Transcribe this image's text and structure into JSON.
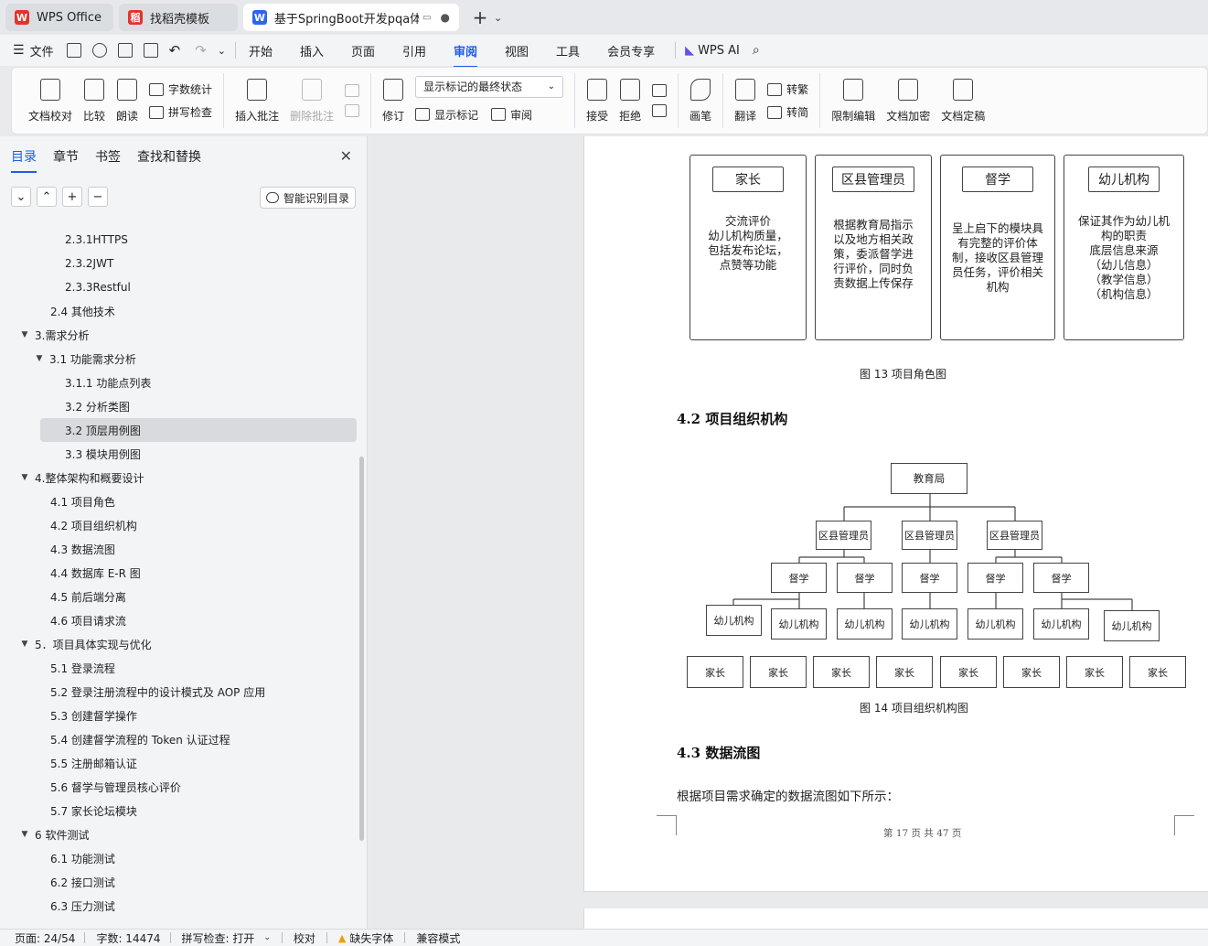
{
  "tabs": [
    {
      "label": "WPS Office",
      "logo": "W",
      "color": "#e5322d"
    },
    {
      "label": "找稻壳模板",
      "logo": "稻",
      "color": "#e5322d"
    },
    {
      "label": "基于SpringBoot开发pqa体系",
      "logo": "W",
      "color": "#2d64f2"
    }
  ],
  "tab_add": "+",
  "tab_more": "⌄",
  "menu": {
    "file": "文件",
    "items": [
      "开始",
      "插入",
      "页面",
      "引用",
      "审阅",
      "视图",
      "工具",
      "会员专享"
    ],
    "active": "审阅",
    "ai": "WPS AI"
  },
  "ribbon": {
    "doc_check": "文档校对",
    "compare": "比较",
    "read": "朗读",
    "word_count": "字数统计",
    "spell_check": "拼写检查",
    "insert_comment": "插入批注",
    "delete_comment": "删除批注",
    "revise": "修订",
    "markup_state": "显示标记的最终状态",
    "show_markup": "显示标记",
    "review": "审阅",
    "accept": "接受",
    "reject": "拒绝",
    "pen": "画笔",
    "translate": "翻译",
    "to_traditional": "转繁",
    "to_simplified": "转简",
    "restrict_edit": "限制编辑",
    "encrypt": "文档加密",
    "finalize": "文档定稿"
  },
  "nav": {
    "tabs": [
      "目录",
      "章节",
      "书签",
      "查找和替换"
    ],
    "active_tab": "目录",
    "tools": [
      "⌄",
      "⌃",
      "+",
      "−"
    ],
    "smart_button": "智能识别目录",
    "toc": [
      {
        "text": "2.3.1HTTPS",
        "level": 3,
        "caret": ""
      },
      {
        "text": "2.3.2JWT",
        "level": 3,
        "caret": ""
      },
      {
        "text": "2.3.3Restful",
        "level": 3,
        "caret": ""
      },
      {
        "text": "2.4 其他技术",
        "level": 2,
        "caret": ""
      },
      {
        "text": "3.需求分析",
        "level": 1,
        "caret": "▼"
      },
      {
        "text": "3.1 功能需求分析",
        "level": 2,
        "caret": "▼"
      },
      {
        "text": "3.1.1  功能点列表",
        "level": 3,
        "caret": ""
      },
      {
        "text": "3.2  分析类图",
        "level": 3,
        "caret": ""
      },
      {
        "text": "3.2  顶层用例图",
        "level": 3,
        "caret": "",
        "selected": true
      },
      {
        "text": "3.3  模块用例图",
        "level": 3,
        "caret": ""
      },
      {
        "text": "4.整体架构和概要设计",
        "level": 1,
        "caret": "▼"
      },
      {
        "text": "4.1  项目角色",
        "level": 2,
        "caret": ""
      },
      {
        "text": "4.2  项目组织机构",
        "level": 2,
        "caret": ""
      },
      {
        "text": "4.3  数据流图",
        "level": 2,
        "caret": ""
      },
      {
        "text": "4.4 数据库 E-R 图",
        "level": 2,
        "caret": ""
      },
      {
        "text": "4.5  前后端分离",
        "level": 2,
        "caret": ""
      },
      {
        "text": "4.6  项目请求流",
        "level": 2,
        "caret": ""
      },
      {
        "text": "5．项目具体实现与优化",
        "level": 1,
        "caret": "▼"
      },
      {
        "text": "5.1 登录流程",
        "level": 2,
        "caret": ""
      },
      {
        "text": "5.2 登录注册流程中的设计模式及 AOP 应用",
        "level": 2,
        "caret": ""
      },
      {
        "text": "5.3 创建督学操作",
        "level": 2,
        "caret": ""
      },
      {
        "text": "5.4 创建督学流程的 Token 认证过程",
        "level": 2,
        "caret": ""
      },
      {
        "text": "5.5 注册邮箱认证",
        "level": 2,
        "caret": ""
      },
      {
        "text": "5.6 督学与管理员核心评价",
        "level": 2,
        "caret": ""
      },
      {
        "text": "5.7 家长论坛模块",
        "level": 2,
        "caret": ""
      },
      {
        "text": "6 软件测试",
        "level": 1,
        "caret": "▼"
      },
      {
        "text": "6.1 功能测试",
        "level": 2,
        "caret": ""
      },
      {
        "text": "6.2  接口测试",
        "level": 2,
        "caret": ""
      },
      {
        "text": "6.3  压力测试",
        "level": 2,
        "caret": ""
      }
    ]
  },
  "document": {
    "roles": [
      {
        "title": "家长",
        "text": "交流评价\n幼儿机构质量，\n包括发布论坛，\n点赞等功能"
      },
      {
        "title": "区县管理员",
        "text": "根据教育局指示\n以及地方相关政\n策，委派督学进\n行评价，同时负\n责数据上传保存"
      },
      {
        "title": "督学",
        "text": "呈上启下的模块具\n有完整的评价体\n制，接收区县管理\n员任务，评价相关\n机构"
      },
      {
        "title": "幼儿机构",
        "text": "保证其作为幼儿机\n构的职责\n底层信息来源\n（幼儿信息）\n（教学信息）\n（机构信息）"
      }
    ],
    "caption13": "图  13  项目角色图",
    "heading42": "4.2  项目组织机构",
    "org": {
      "root": "教育局",
      "admin": "区县管理员",
      "supervisor": "督学",
      "institution": "幼儿机构",
      "parent": "家长"
    },
    "caption14": "图  14  项目组织机构图",
    "heading43": "4.3  数据流图",
    "para": "根据项目需求确定的数据流图如下所示：",
    "footer": "第  17  页   共  47  页"
  },
  "status": {
    "page": "页面: 24/54",
    "words": "字数: 14474",
    "spell": "拼写检查: 打开",
    "proof": "校对",
    "missing_font": "缺失字体",
    "compat": "兼容模式"
  }
}
